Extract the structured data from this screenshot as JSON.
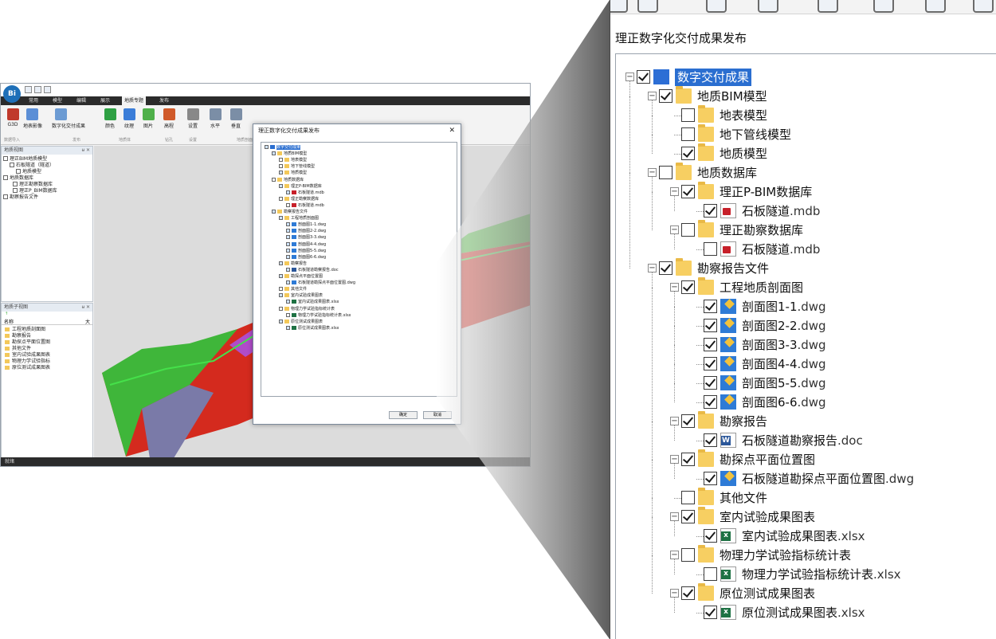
{
  "app": {
    "logo": "Bi",
    "menus": [
      "常用",
      "模型",
      "编辑",
      "展示",
      "地质专题",
      "发布"
    ],
    "active_menu_index": 4,
    "ribbon": [
      {
        "label": "G3D",
        "icon": "g3d-icon"
      },
      {
        "label": "地表影像",
        "icon": "surface-image-icon"
      },
      {
        "label": "数字化交付成果",
        "icon": "digital-delivery-icon"
      },
      {
        "label": "颜色",
        "icon": "color-icon"
      },
      {
        "label": "纹理",
        "icon": "texture-icon"
      },
      {
        "label": "图片",
        "icon": "picture-icon"
      },
      {
        "label": "高程",
        "icon": "elevation-icon"
      },
      {
        "label": "设置",
        "icon": "settings-icon"
      },
      {
        "label": "水平",
        "icon": "horizontal-icon"
      },
      {
        "label": "垂直",
        "icon": "vertical-icon"
      }
    ],
    "ribbon_groups": [
      "数据导入",
      "发布",
      "地质体",
      "钻孔",
      "设置",
      "地质剖面"
    ],
    "left_panel": {
      "title": "地质视图",
      "items": [
        "理正BIM地质模型",
        "石板隧道（隧道）",
        "地质模型",
        "地质数据库",
        "理正勘察数据库",
        "理正P_BIM数据库",
        "勘察报告文件"
      ]
    },
    "sub_panel": {
      "title": "地质子视图",
      "columns": [
        "名称",
        "大"
      ],
      "items": [
        "工程地质剖面图",
        "勘察报告",
        "勘探点平面位置图",
        "其他文件",
        "室内试验成果图表",
        "物理力学试验指标",
        "原位测试成果图表"
      ]
    },
    "status": "就绪"
  },
  "dialog": {
    "title": "理正数字化交付成果发布",
    "ok_label": "确定",
    "cancel_label": "取消",
    "close_glyph": "✕"
  },
  "tree": [
    {
      "level": 0,
      "label": "数字交付成果",
      "checked": true,
      "expander": "-",
      "icon": "folder-blue",
      "selected": true
    },
    {
      "level": 1,
      "label": "地质BIM模型",
      "checked": true,
      "expander": "-",
      "icon": "folder"
    },
    {
      "level": 2,
      "label": "地表模型",
      "checked": false,
      "expander": "",
      "icon": "folder"
    },
    {
      "level": 2,
      "label": "地下管线模型",
      "checked": false,
      "expander": "",
      "icon": "folder"
    },
    {
      "level": 2,
      "label": "地质模型",
      "checked": true,
      "expander": "",
      "icon": "folder"
    },
    {
      "level": 1,
      "label": "地质数据库",
      "checked": false,
      "expander": "-",
      "icon": "folder"
    },
    {
      "level": 2,
      "label": "理正P-BIM数据库",
      "checked": true,
      "expander": "-",
      "icon": "folder"
    },
    {
      "level": 3,
      "label": "石板隧道",
      "ext": ".mdb",
      "checked": true,
      "expander": "",
      "icon": "mdb"
    },
    {
      "level": 2,
      "label": "理正勘察数据库",
      "checked": false,
      "expander": "-",
      "icon": "folder"
    },
    {
      "level": 3,
      "label": "石板隧道",
      "ext": ".mdb",
      "checked": false,
      "expander": "",
      "icon": "mdb"
    },
    {
      "level": 1,
      "label": "勘察报告文件",
      "checked": true,
      "expander": "-",
      "icon": "folder"
    },
    {
      "level": 2,
      "label": "工程地质剖面图",
      "checked": true,
      "expander": "-",
      "icon": "folder"
    },
    {
      "level": 3,
      "label": "剖面图1-1",
      "ext": ".dwg",
      "checked": true,
      "expander": "",
      "icon": "dwg"
    },
    {
      "level": 3,
      "label": "剖面图2-2",
      "ext": ".dwg",
      "checked": true,
      "expander": "",
      "icon": "dwg"
    },
    {
      "level": 3,
      "label": "剖面图3-3",
      "ext": ".dwg",
      "checked": true,
      "expander": "",
      "icon": "dwg"
    },
    {
      "level": 3,
      "label": "剖面图4-4",
      "ext": ".dwg",
      "checked": true,
      "expander": "",
      "icon": "dwg"
    },
    {
      "level": 3,
      "label": "剖面图5-5",
      "ext": ".dwg",
      "checked": true,
      "expander": "",
      "icon": "dwg"
    },
    {
      "level": 3,
      "label": "剖面图6-6",
      "ext": ".dwg",
      "checked": true,
      "expander": "",
      "icon": "dwg"
    },
    {
      "level": 2,
      "label": "勘察报告",
      "checked": true,
      "expander": "-",
      "icon": "folder"
    },
    {
      "level": 3,
      "label": "石板隧道勘察报告",
      "ext": ".doc",
      "checked": true,
      "expander": "",
      "icon": "doc"
    },
    {
      "level": 2,
      "label": "勘探点平面位置图",
      "checked": true,
      "expander": "-",
      "icon": "folder"
    },
    {
      "level": 3,
      "label": "石板隧道勘探点平面位置图",
      "ext": ".dwg",
      "checked": true,
      "expander": "",
      "icon": "dwg"
    },
    {
      "level": 2,
      "label": "其他文件",
      "checked": false,
      "expander": "",
      "icon": "folder"
    },
    {
      "level": 2,
      "label": "室内试验成果图表",
      "checked": true,
      "expander": "-",
      "icon": "folder"
    },
    {
      "level": 3,
      "label": "室内试验成果图表",
      "ext": ".xlsx",
      "checked": true,
      "expander": "",
      "icon": "xls"
    },
    {
      "level": 2,
      "label": "物理力学试验指标统计表",
      "checked": false,
      "expander": "-",
      "icon": "folder"
    },
    {
      "level": 3,
      "label": "物理力学试验指标统计表",
      "ext": ".xlsx",
      "checked": false,
      "expander": "",
      "icon": "xls"
    },
    {
      "level": 2,
      "label": "原位测试成果图表",
      "checked": true,
      "expander": "-",
      "icon": "folder"
    },
    {
      "level": 3,
      "label": "原位测试成果图表",
      "ext": ".xlsx",
      "checked": true,
      "expander": "",
      "icon": "xls"
    }
  ]
}
